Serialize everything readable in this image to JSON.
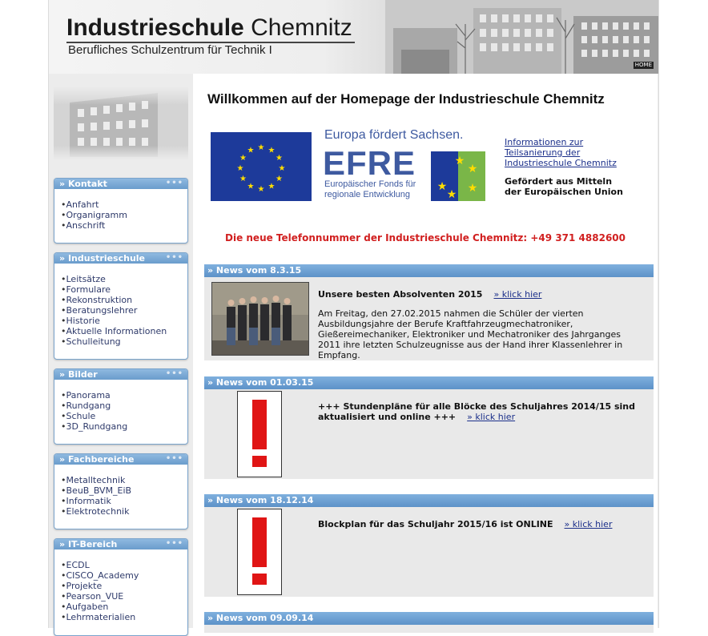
{
  "header": {
    "title_bold": "Industrieschule",
    "title_light": "Chemnitz",
    "subtitle": "Berufliches Schulzentrum für Technik I",
    "home_label": "HOME"
  },
  "sidebar": {
    "boxes": [
      {
        "title": "Kontakt",
        "items": [
          "Anfahrt",
          "Organigramm",
          "Anschrift"
        ]
      },
      {
        "title": "Industrieschule",
        "items": [
          "Leitsätze",
          "Formulare",
          "Rekonstruktion",
          "Beratungslehrer",
          "Historie",
          "Aktuelle Informationen",
          "Schulleitung"
        ]
      },
      {
        "title": "Bilder",
        "items": [
          "Panorama",
          "Rundgang",
          "Schule",
          "3D_Rundgang"
        ]
      },
      {
        "title": "Fachbereiche",
        "items": [
          "Metalltechnik",
          "BeuB_BVM_EiB",
          "Informatik",
          "Elektrotechnik"
        ]
      },
      {
        "title": "IT-Bereich",
        "items": [
          "ECDL",
          "CISCO_Academy",
          "Projekte",
          "Pearson_VUE",
          "Aufgaben",
          "Lehrmaterialien"
        ]
      }
    ],
    "arrow": "»",
    "dots": "•••"
  },
  "main": {
    "welcome": "Willkommen auf der Homepage der Industrieschule Chemnitz",
    "efre": {
      "line1": "Europa fördert Sachsen.",
      "logo": "EFRE",
      "line3a": "Europäischer Fonds für",
      "line3b": "regionale Entwicklung"
    },
    "info_link": [
      "Informationen zur",
      "Teilsanierung der",
      "Industrieschule Chemnitz"
    ],
    "funded": [
      "Gefördert aus Mitteln",
      "der Europäischen Union"
    ],
    "phone": "Die neue Telefonnummer der Industrieschule Chemnitz: +49 371 4882600",
    "news": [
      {
        "header": "» News vom 8.3.15",
        "title": "Unsere besten Absolventen 2015",
        "link": "» klick hier",
        "text": "Am Freitag, den 27.02.2015 nahmen die Schüler der vierten Ausbildungsjahre der Berufe Kraftfahrzeugmechatroniker, Gießereimechaniker, Elektroniker und Mechatroniker des Jahrganges 2011 ihre letzten Schulzeugnisse aus der Hand ihrer Klassenlehrer in Empfang."
      },
      {
        "header": "» News vom 01.03.15",
        "title_line1": "+++ Stundenpläne für alle Blöcke des Schuljahres 2014/15 sind",
        "title_line2": "aktualisiert und online +++",
        "link": "» klick hier"
      },
      {
        "header": "» News vom 18.12.14",
        "title": "Blockplan für das Schuljahr 2015/16 ist ONLINE",
        "link": "» klick hier"
      },
      {
        "header": "» News vom 09.09.14"
      }
    ]
  },
  "colors": {
    "accent": "#6a9ccc",
    "phone": "#d12020",
    "link": "#1b2f8a"
  }
}
